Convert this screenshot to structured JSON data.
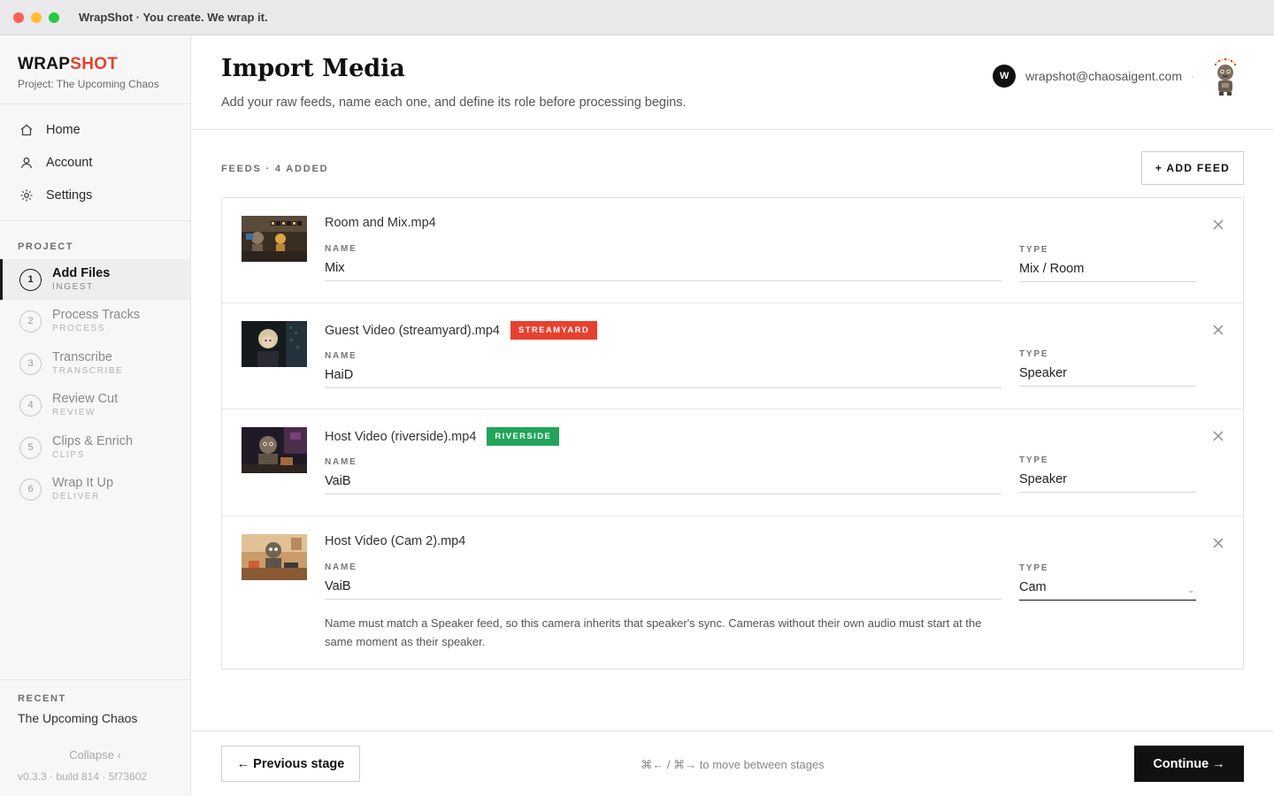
{
  "window": {
    "title": "WrapShot · You create. We wrap it."
  },
  "sidebar": {
    "brand_part1": "WRAP",
    "brand_part2": "SHOT",
    "project": "Project: The Upcoming Chaos",
    "nav": [
      {
        "label": "Home",
        "icon": "home-icon"
      },
      {
        "label": "Account",
        "icon": "user-icon"
      },
      {
        "label": "Settings",
        "icon": "gear-icon"
      }
    ],
    "project_label": "PROJECT",
    "steps": [
      {
        "num": "1",
        "title": "Add Files",
        "sub": "INGEST",
        "active": true
      },
      {
        "num": "2",
        "title": "Process Tracks",
        "sub": "PROCESS"
      },
      {
        "num": "3",
        "title": "Transcribe",
        "sub": "TRANSCRIBE"
      },
      {
        "num": "4",
        "title": "Review Cut",
        "sub": "REVIEW"
      },
      {
        "num": "5",
        "title": "Clips & Enrich",
        "sub": "CLIPS"
      },
      {
        "num": "6",
        "title": "Wrap It Up",
        "sub": "DELIVER"
      }
    ],
    "recent_label": "RECENT",
    "recent_item": "The Upcoming Chaos",
    "collapse": "Collapse ‹",
    "version": "v0.3.3 · build 814 · 5f73602"
  },
  "header": {
    "title": "Import Media",
    "subtitle": "Add your raw feeds, name each one, and define its role before processing begins.",
    "user_initial": "W",
    "user_email": "wrapshot@chaosaigent.com",
    "user_dot": "·"
  },
  "feeds": {
    "label": "FEEDS · 4 ADDED",
    "add_button": "+ ADD FEED",
    "name_label": "NAME",
    "type_label": "TYPE",
    "items": [
      {
        "file": "Room and Mix.mp4",
        "name": "Mix",
        "type": "Mix / Room"
      },
      {
        "file": "Guest Video (streamyard).mp4",
        "badge": "STREAMYARD",
        "badge_color": "#e8402e",
        "name": "HaiD",
        "type": "Speaker"
      },
      {
        "file": "Host Video (riverside).mp4",
        "badge": "RIVERSIDE",
        "badge_color": "#22a45a",
        "name": "VaiB",
        "type": "Speaker"
      },
      {
        "file": "Host Video (Cam 2).mp4",
        "name": "VaiB",
        "type": "Cam",
        "chevron": "⌄",
        "hint": "Name must match a Speaker feed, so this camera inherits that speaker's sync. Cameras without their own audio must start at the same moment as their speaker."
      }
    ]
  },
  "footer": {
    "prev": "← Previous stage",
    "hint": "⌘← / ⌘→ to move between stages",
    "continue": "Continue →"
  },
  "colors": {
    "accent": "#e0432f",
    "dark": "#111111",
    "streamyard": "#e8402e",
    "riverside": "#22a45a"
  }
}
